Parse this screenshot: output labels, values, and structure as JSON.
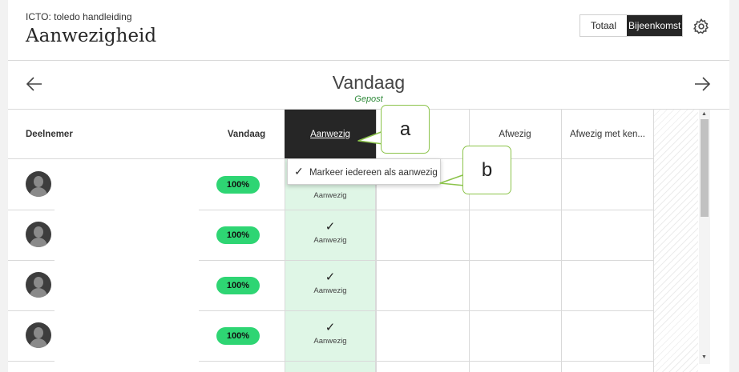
{
  "header": {
    "course": "ICTO: toledo handleiding",
    "title": "Aanwezigheid",
    "view_toggle": [
      "Totaal",
      "Bijeenkomst"
    ],
    "settings_icon": "gear-icon"
  },
  "date_nav": {
    "title": "Vandaag",
    "status": "Gepost",
    "prev_icon": "arrow-left-icon",
    "next_icon": "arrow-right-icon"
  },
  "table": {
    "columns": [
      "Deelnemer",
      "Vandaag",
      "Aanwezig",
      "Te laat",
      "Afwezig",
      "Afwezig met ken..."
    ],
    "visible_partial_header": "at",
    "rows": [
      {
        "score": "100%",
        "status": "Aanwezig"
      },
      {
        "score": "100%",
        "status": "Aanwezig"
      },
      {
        "score": "100%",
        "status": "Aanwezig"
      },
      {
        "score": "100%",
        "status": "Aanwezig"
      }
    ],
    "check_glyph": "✓"
  },
  "dropdown": {
    "check": "✓",
    "label": "Markeer iedereen als aanwezig"
  },
  "callouts": [
    "a",
    "b"
  ],
  "colors": {
    "selected_header": "#262626",
    "present_column": "#dff6e6",
    "score_pill": "#2ed573",
    "posted_text": "#2f8a3a",
    "callout_border": "#8bc34a"
  }
}
